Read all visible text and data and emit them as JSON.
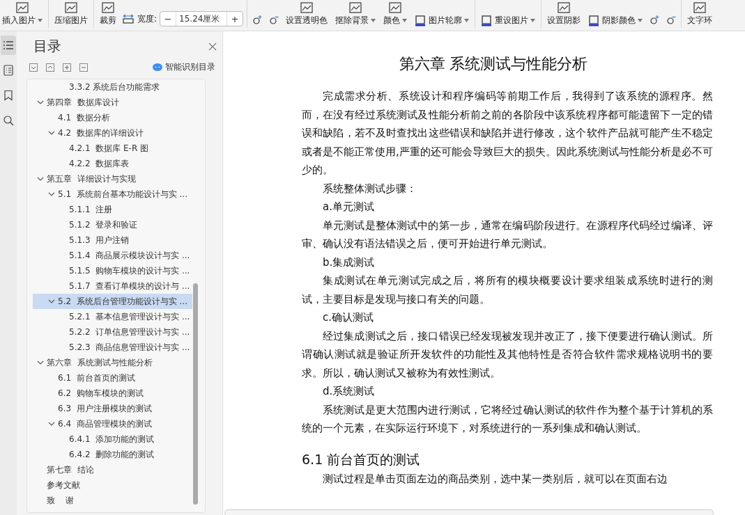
{
  "toolbar": {
    "tools": [
      {
        "kind": "big",
        "label": "插入图片",
        "dropdown": true
      },
      {
        "kind": "big",
        "label": "压缩图片",
        "dropdown": false
      },
      {
        "kind": "big",
        "label": "裁剪",
        "dropdown": false
      },
      {
        "kind": "size",
        "label": "宽度:",
        "value": "15.24厘米",
        "minus": "−",
        "plus": "+"
      },
      {
        "kind": "pair"
      },
      {
        "kind": "big",
        "label": "设置透明色",
        "dropdown": false
      },
      {
        "kind": "big",
        "label": "抠除背景",
        "dropdown": true
      },
      {
        "kind": "big",
        "label": "颜色",
        "dropdown": true
      },
      {
        "kind": "small",
        "label": "图片轮廓",
        "dropdown": true
      },
      {
        "kind": "small",
        "label": "重设图片",
        "dropdown": true
      },
      {
        "kind": "big",
        "label": "设置阴影",
        "dropdown": false
      },
      {
        "kind": "small",
        "label": "阴影颜色",
        "dropdown": true
      },
      {
        "kind": "pair"
      },
      {
        "kind": "big",
        "label": "文字环",
        "dropdown": false
      }
    ]
  },
  "side_tabs": [
    {
      "kind": "outline",
      "selected": true
    },
    {
      "kind": "pages",
      "selected": false
    },
    {
      "kind": "bookmark",
      "selected": false
    },
    {
      "kind": "find",
      "selected": false
    }
  ],
  "toc": {
    "title": "目录",
    "smart_button": "智能识别目录",
    "items": [
      {
        "children": [
          {
            "children": [
              {
                "label": "3.3.2 系统后台功能需求",
                "selected": false
              }
            ]
          }
        ]
      },
      {
        "label": "第四章  数据库设计",
        "expanded": true,
        "selected": false,
        "children": [
          {
            "label": "4.1  数据分析",
            "selected": false
          },
          {
            "label": "4.2  数据库的详细设计",
            "expanded": true,
            "selected": false,
            "children": [
              {
                "label": "4.2.1  数据库 E-R 图",
                "selected": false
              },
              {
                "label": "4.2.2  数据库表",
                "selected": false
              }
            ]
          }
        ]
      },
      {
        "label": "第五章  详细设计与实现",
        "expanded": true,
        "selected": false,
        "children": [
          {
            "label": "5.1  系统前台基本功能设计与实 ...",
            "expanded": true,
            "selected": false,
            "children": [
              {
                "label": "5.1.1  注册",
                "selected": false
              },
              {
                "label": "5.1.2  登录和验证",
                "selected": false
              },
              {
                "label": "5.1.3  用户注销",
                "selected": false
              },
              {
                "label": "5.1.4  商品展示模块设计与实 ...",
                "selected": false
              },
              {
                "label": "5.1.5  购物车模块的设计与实 ...",
                "selected": false
              },
              {
                "label": "5.1.7  查看订单模块的设计与 ...",
                "selected": false
              }
            ]
          },
          {
            "label": "5.2  系统后台管理功能设计与实 ...",
            "expanded": true,
            "selected": true,
            "children": [
              {
                "label": "5.2.1  基本信息管理设计与实 ...",
                "selected": false
              },
              {
                "label": "5.2.2  订单信息管理设计与实 ...",
                "selected": false
              },
              {
                "label": "5.2.3  商品信息管理设计与实 ...",
                "selected": false
              }
            ]
          }
        ]
      },
      {
        "label": "第六章  系统测试与性能分析",
        "expanded": true,
        "selected": false,
        "children": [
          {
            "label": "6.1  前台首页的测试",
            "selected": false
          },
          {
            "label": "6.2  购物车模块的测试",
            "selected": false
          },
          {
            "label": "6.3  用户注册模块的测试",
            "selected": false
          },
          {
            "label": "6.4  商品管理模块的测试",
            "expanded": true,
            "selected": false,
            "children": [
              {
                "label": "6.4.1  添加功能的测试",
                "selected": false
              },
              {
                "label": "6.4.2  删除功能的测试",
                "selected": false
              }
            ]
          }
        ]
      },
      {
        "label": "第七章  结论",
        "selected": false
      },
      {
        "label": "参考文献",
        "selected": false
      },
      {
        "label": "致    谢",
        "selected": false
      }
    ]
  },
  "document": {
    "blocks": [
      {
        "kind": "title",
        "text": "第六章  系统测试与性能分析"
      },
      {
        "kind": "para",
        "text": "完成需求分析、系统设计和程序编码等前期工作后，我得到了该系统的源程序。然而，在没有经过系统测试及性能分析前之前的各阶段中该系统程序都可能遗留下一定的错误和缺陷，若不及时查找出这些错误和缺陷并进行修改，这个软件产品就可能产生不稳定或者是不能正常使用,严重的还可能会导致巨大的损失。因此系统测试与性能分析是必不可少的。"
      },
      {
        "kind": "para",
        "text": "系统整体测试步骤："
      },
      {
        "kind": "para",
        "text": "a.单元测试"
      },
      {
        "kind": "para",
        "text": "单元测试是整体测试中的第一步，通常在编码阶段进行。在源程序代码经过编译、评审、确认没有语法错误之后，便可开始进行单元测试。"
      },
      {
        "kind": "para",
        "text": "b.集成测试"
      },
      {
        "kind": "para",
        "text": "集成测试在单元测试完成之后，将所有的模块概要设计要求组装成系统时进行的测试，主要目标是发现与接口有关的问题。"
      },
      {
        "kind": "para",
        "text": "c.确认测试"
      },
      {
        "kind": "para",
        "text": "经过集成测试之后，接口错误已经发现被发现并改正了，接下便要进行确认测试。所谓确认测试就是验证所开发软件的功能性及其他特性是否符合软件需求规格说明书的要求。所以，确认测试又被称为有效性测试。"
      },
      {
        "kind": "para",
        "text": "d.系统测试"
      },
      {
        "kind": "para",
        "text": "系统测试是更大范围内进行测试，它将经过确认测试的软件作为整个基于计算机的系统的一个元素，在实际运行环境下，对系统进行的一系列集成和确认测试。"
      },
      {
        "kind": "heading",
        "text": "6.1  前台首页的测试"
      },
      {
        "kind": "para",
        "text": "测试过程是单击页面左边的商品类别，选中某一类别后，就可以在页面右边"
      }
    ]
  }
}
